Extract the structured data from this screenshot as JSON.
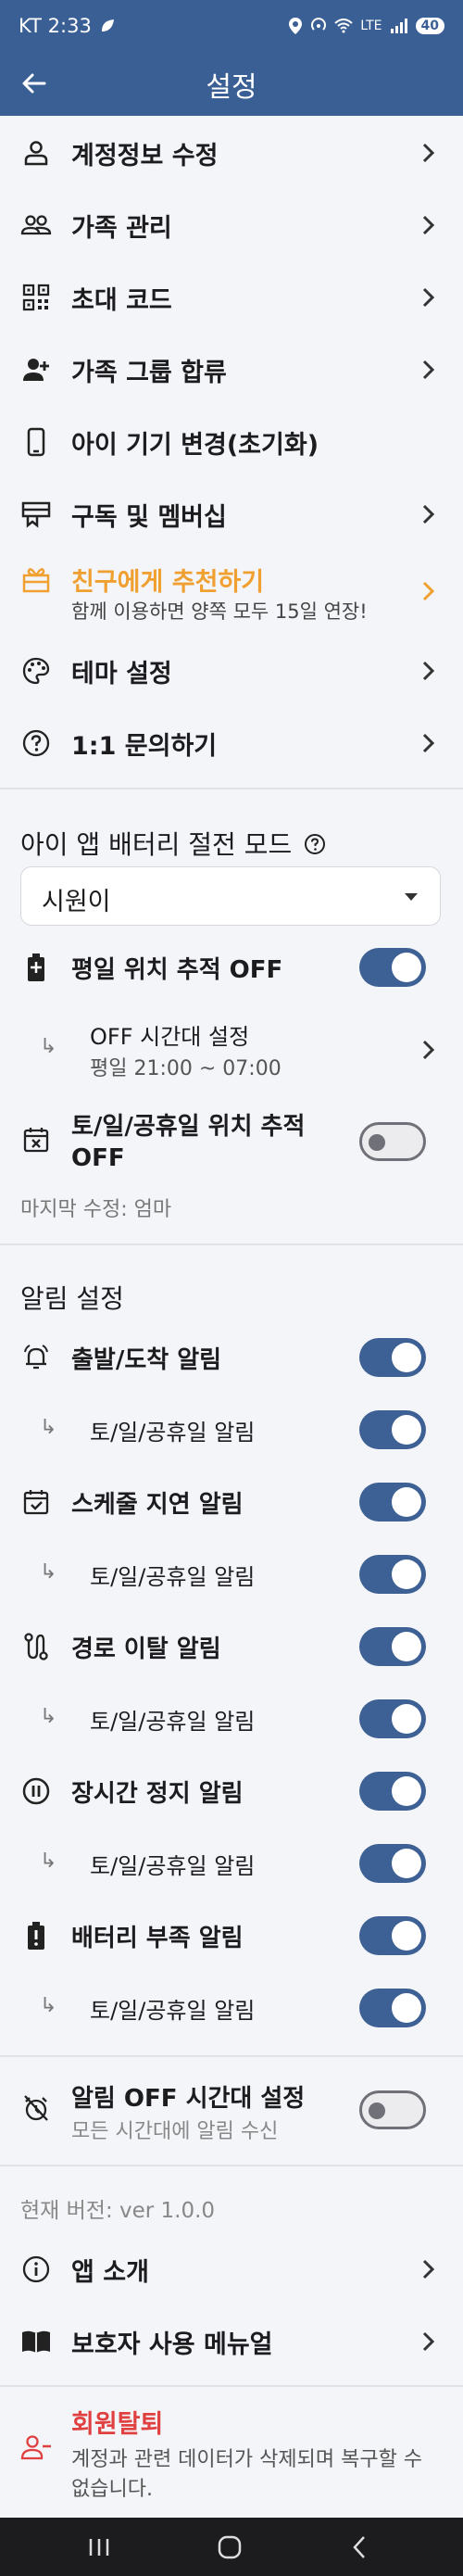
{
  "status_bar": {
    "carrier_time": "KT 2:33",
    "network": "LTE",
    "battery": "40"
  },
  "app_bar": {
    "title": "설정"
  },
  "menu": {
    "edit_account": "계정정보 수정",
    "family": "가족 관리",
    "invite_code": "초대 코드",
    "join_group": "가족 그룹 합류",
    "change_device": "아이 기기 변경(초기화)",
    "subscription": "구독 및 멤버십",
    "recommend": "친구에게 추천하기",
    "recommend_sub": "함께 이용하면 양쪽 모두 15일 연장!",
    "theme": "테마 설정",
    "inquiry": "1:1 문의하기"
  },
  "battery_mode": {
    "title": "아이 앱 배터리 절전 모드",
    "selected_child": "시원이",
    "weekday_label": "평일 위치 추적 OFF",
    "weekday_on": true,
    "off_time_label": "OFF 시간대 설정",
    "off_time_value": "평일 21:00 ~ 07:00",
    "weekend_label_1": "토/일/공휴일 위치 추적",
    "weekend_label_2": "OFF",
    "weekend_on": false,
    "last_modified": "마지막 수정: 엄마"
  },
  "alerts": {
    "title": "알림 설정",
    "weekend_label": "토/일/공휴일 알림",
    "items": [
      {
        "label": "출발/도착 알림",
        "on": true,
        "weekend_on": true
      },
      {
        "label": "스케줄 지연 알림",
        "on": true,
        "weekend_on": true
      },
      {
        "label": "경로 이탈 알림",
        "on": true,
        "weekend_on": true
      },
      {
        "label": "장시간 정지 알림",
        "on": true,
        "weekend_on": true
      },
      {
        "label": "배터리 부족 알림",
        "on": true,
        "weekend_on": true
      }
    ],
    "off_time_label": "알림 OFF 시간대 설정",
    "off_time_sub": "모든 시간대에 알림 수신",
    "off_time_on": false
  },
  "info": {
    "version": "현재 버전: ver 1.0.0",
    "about": "앱 소개",
    "manual": "보호자 사용 메뉴얼"
  },
  "withdraw": {
    "label": "회원탈퇴",
    "desc_1": "계정과 관련 데이터가 삭제되며 복구할 수",
    "desc_2": "없습니다."
  },
  "colors": {
    "primary": "#3a5f95",
    "accent": "#f0a030",
    "danger": "#e04040",
    "toggle_on": "#3d6194"
  }
}
